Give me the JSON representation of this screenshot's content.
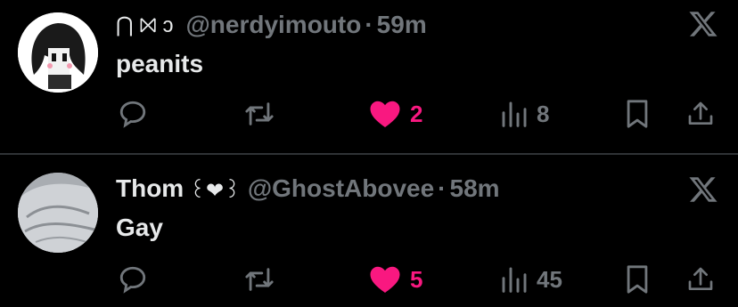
{
  "tweets": [
    {
      "display_name": "",
      "name_decor": "⋂ ⨝ ɔ",
      "handle": "@nerdyimouto",
      "separator": "·",
      "time": "59m",
      "text": "peanits",
      "likes": "2",
      "views": "8",
      "liked": true
    },
    {
      "display_name": "Thom",
      "name_decor": "꒰❤︎꒱",
      "handle": "@GhostAbovee",
      "separator": "·",
      "time": "58m",
      "text": "Gay",
      "likes": "5",
      "views": "45",
      "liked": true
    }
  ],
  "colors": {
    "background": "#000000",
    "primary_text": "#e7e9ea",
    "secondary_text": "#71767b",
    "like_pink": "#f91880",
    "divider": "#2f3336"
  },
  "icons": [
    "reply-icon",
    "retweet-icon",
    "heart-icon",
    "views-icon",
    "bookmark-icon",
    "share-icon",
    "x-logo-icon"
  ]
}
